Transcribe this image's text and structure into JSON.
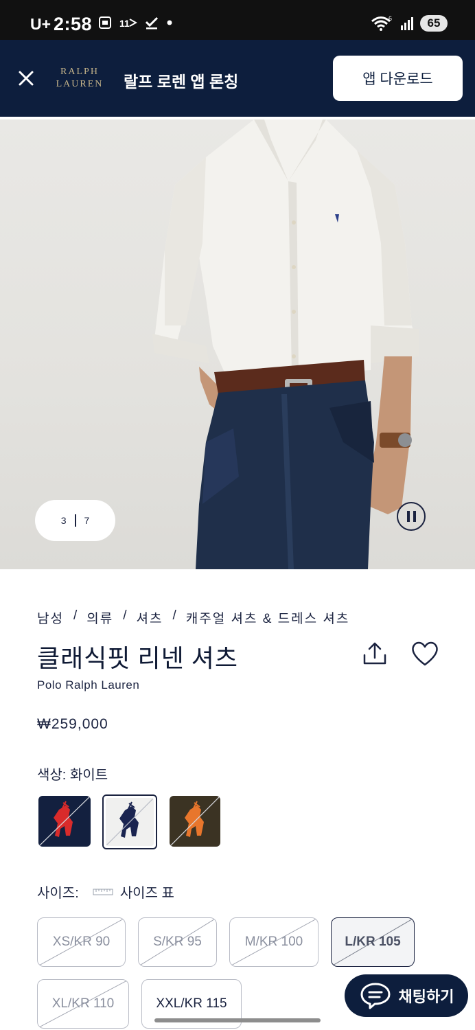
{
  "status_bar": {
    "time": "2:58",
    "carrier": "U+",
    "battery": "65",
    "icons": [
      "screenshot-icon",
      "eleven-street-icon",
      "check-icon",
      "dot-icon",
      "wifi-icon",
      "signal-icon"
    ]
  },
  "banner": {
    "logo_line1": "RALPH",
    "logo_line2": "LAUREN",
    "title": "랄프 로렌 앱 론칭",
    "download_label": "앱 다운로드",
    "colors": {
      "background": "#0d1e3d",
      "logo": "#c5b48a"
    }
  },
  "gallery": {
    "current": "3",
    "total": "7",
    "image_alt": "man wearing white linen shirt with dark jeans"
  },
  "breadcrumb": [
    "남성",
    "의류",
    "셔츠",
    "캐주얼 셔츠 & 드레스 셔츠"
  ],
  "product": {
    "title": "클래식핏 리넨 셔츠",
    "brand": "Polo Ralph Lauren",
    "price": "₩259,000"
  },
  "color": {
    "label": "색상: 화이트",
    "swatches": [
      {
        "name": "navy",
        "bg": "#13203f",
        "pony": "#d92b2b",
        "selected": false
      },
      {
        "name": "white",
        "bg": "#f0f0ef",
        "pony": "#1a2450",
        "selected": true
      },
      {
        "name": "olive",
        "bg": "#3b3323",
        "pony": "#e8762c",
        "selected": false
      }
    ]
  },
  "size": {
    "label": "사이즈:",
    "chart_label": "사이즈 표",
    "options": [
      {
        "label": "XS/KR 90",
        "available": false,
        "selected": false
      },
      {
        "label": "S/KR 95",
        "available": false,
        "selected": false
      },
      {
        "label": "M/KR 100",
        "available": false,
        "selected": false
      },
      {
        "label": "L/KR 105",
        "available": false,
        "selected": true
      },
      {
        "label": "XL/KR 110",
        "available": false,
        "selected": false
      },
      {
        "label": "XXL/KR 115",
        "available": true,
        "selected": false
      }
    ]
  },
  "chat": {
    "label": "채팅하기"
  }
}
